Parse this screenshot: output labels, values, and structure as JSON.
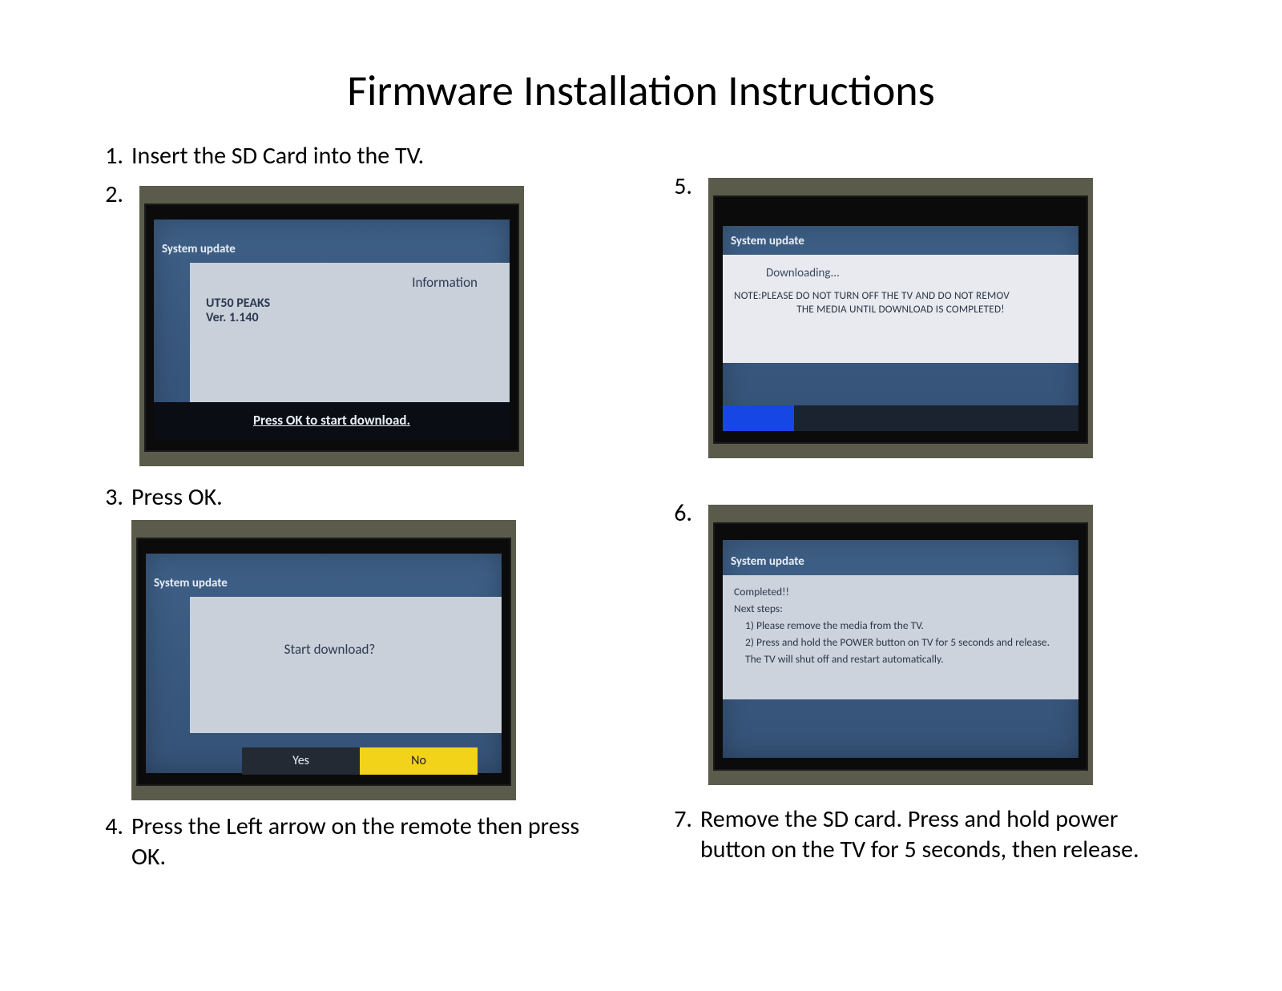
{
  "title": "Firmware Installation Instructions",
  "steps": {
    "s1": {
      "num": "1.",
      "text": "Insert the SD Card into the TV."
    },
    "s2": {
      "num": "2."
    },
    "s3": {
      "num": "3.",
      "text": "Press OK."
    },
    "s4": {
      "num": "4.",
      "text": "Press the Left arrow on the remote then press OK."
    },
    "s5": {
      "num": "5."
    },
    "s6": {
      "num": "6."
    },
    "s7": {
      "num": "7.",
      "text": "Remove the SD card.  Press and hold power button on the TV for 5 seconds, then release."
    }
  },
  "screens": {
    "info": {
      "header": "System update",
      "infoLabel": "Information",
      "model": "UT50 PEAKS",
      "version": "Ver. 1.140",
      "footer": "Press OK to start download."
    },
    "confirm": {
      "header": "System update",
      "prompt": "Start download?",
      "yes": "Yes",
      "no": "No"
    },
    "downloading": {
      "header": "System update",
      "status": "Downloading...",
      "note1": "NOTE:PLEASE DO NOT TURN OFF THE TV AND DO NOT REMOV",
      "note2": "THE MEDIA UNTIL DOWNLOAD IS COMPLETED!"
    },
    "completed": {
      "header": "System update",
      "line1": "Completed!!",
      "line2": "Next steps:",
      "line3": "1) Please remove the media from the TV.",
      "line4": "2) Press and hold the POWER button on TV for 5 seconds and release.",
      "line5": "The TV will shut off and restart automatically."
    }
  }
}
